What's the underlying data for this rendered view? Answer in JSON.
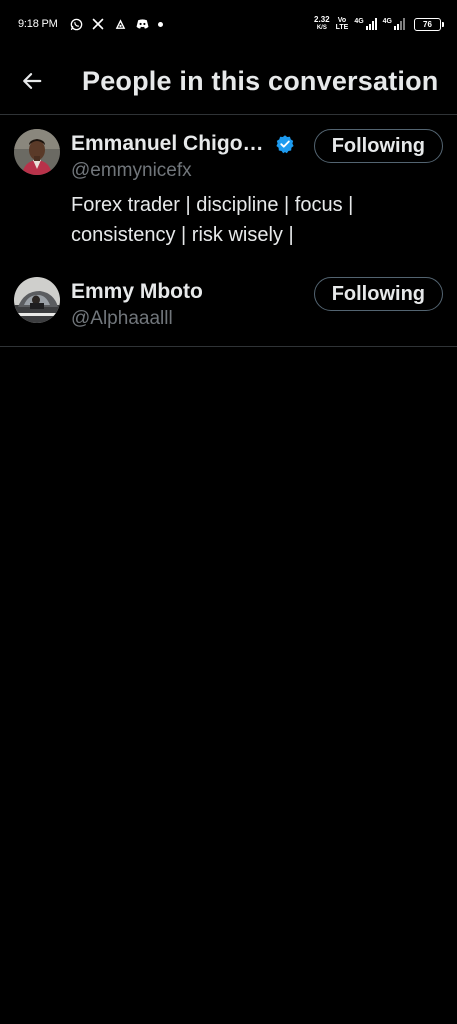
{
  "status_bar": {
    "time": "9:18 PM",
    "speed_value": "2.32",
    "speed_unit": "K/S",
    "volte_top": "Vo",
    "volte_bottom": "LTE",
    "net1": "4G",
    "net2": "4G",
    "battery": "76"
  },
  "header": {
    "title": "People in this conversation"
  },
  "people": [
    {
      "name": "Emmanuel Chigozie",
      "handle": "@emmynicefx",
      "verified": true,
      "bio": "Forex trader | discipline | focus | consistency | risk wisely |",
      "follow_label": "Following"
    },
    {
      "name": "Emmy Mboto",
      "handle": "@Alphaaalll",
      "verified": false,
      "bio": "",
      "follow_label": "Following"
    }
  ],
  "colors": {
    "background": "#000000",
    "text_primary": "#e7e9ea",
    "text_secondary": "#71767b",
    "divider": "#2f3336",
    "verified_blue": "#1d9bf0"
  }
}
